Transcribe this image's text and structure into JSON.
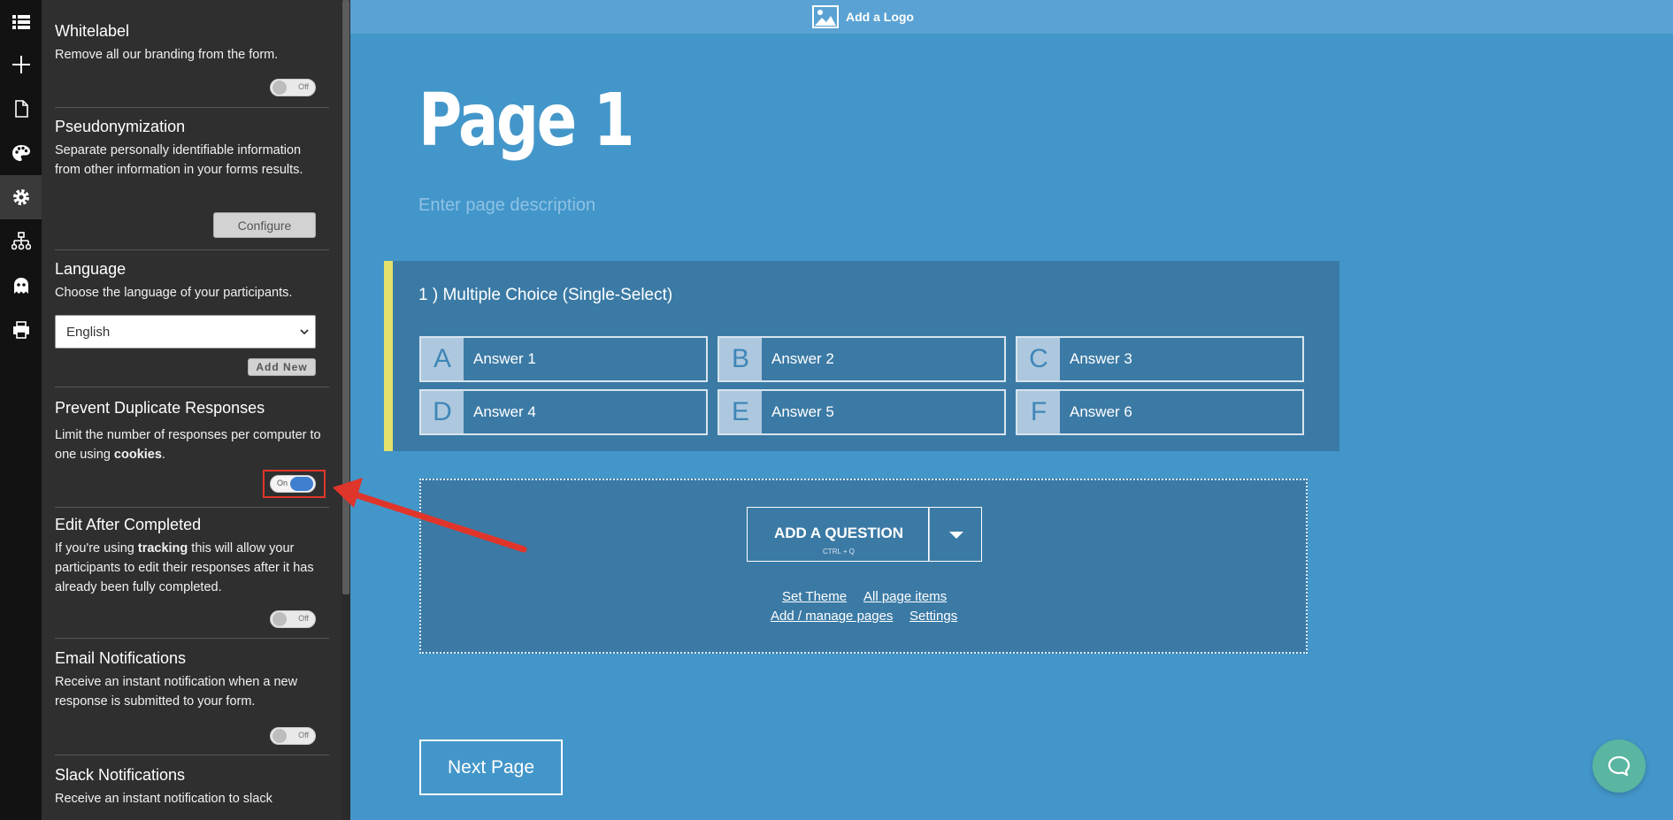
{
  "sidebar": {
    "sections": {
      "whitelabel": {
        "title": "Whitelabel",
        "desc": "Remove all our branding from the form.",
        "toggle": "Off"
      },
      "pseudonymization": {
        "title": "Pseudonymization",
        "desc": "Separate personally identifiable information from other information in your forms results.",
        "button": "Configure"
      },
      "language": {
        "title": "Language",
        "desc": "Choose the language of your participants.",
        "selected": "English",
        "add_new": "Add New"
      },
      "duplicate": {
        "title": "Prevent Duplicate Responses",
        "desc_pre": "Limit the number of responses per computer to one using ",
        "desc_bold": "cookies",
        "desc_post": ".",
        "toggle": "On"
      },
      "edit_after": {
        "title": "Edit After Completed",
        "desc_pre": "If you're using ",
        "desc_bold": "tracking",
        "desc_post": " this will allow your participants to edit their responses after it has already been fully completed.",
        "toggle": "Off"
      },
      "email": {
        "title": "Email Notifications",
        "desc": "Receive an instant notification when a new response is submitted to your form.",
        "toggle": "Off"
      },
      "slack": {
        "title": "Slack Notifications",
        "desc": "Receive an instant notification to slack"
      }
    }
  },
  "topbar": {
    "logo_label": "Add a Logo"
  },
  "page": {
    "title": "Page 1",
    "description_placeholder": "Enter page description"
  },
  "question": {
    "title": "1 )  Multiple Choice (Single-Select)",
    "answers": [
      {
        "letter": "A",
        "text": "Answer 1"
      },
      {
        "letter": "B",
        "text": "Answer 2"
      },
      {
        "letter": "C",
        "text": "Answer 3"
      },
      {
        "letter": "D",
        "text": "Answer 4"
      },
      {
        "letter": "E",
        "text": "Answer 5"
      },
      {
        "letter": "F",
        "text": "Answer 6"
      }
    ]
  },
  "add_area": {
    "button": "ADD A QUESTION",
    "shortcut": "CTRL + Q",
    "links": {
      "set_theme": "Set Theme",
      "all_items": "All page items",
      "manage_pages": "Add / manage pages",
      "settings": "Settings"
    }
  },
  "next_button": "Next Page",
  "colors": {
    "background": "#4396c9",
    "panel": "#2f2f2f",
    "accent_bar": "#e4e26a",
    "toggle_on": "#3f7fd0",
    "callout": "#e0352b"
  },
  "icons": [
    "list-icon",
    "plus-icon",
    "page-icon",
    "palette-icon",
    "gear-icon",
    "sitemap-icon",
    "ghost-icon",
    "printer-icon",
    "image-icon",
    "chat-icon"
  ]
}
